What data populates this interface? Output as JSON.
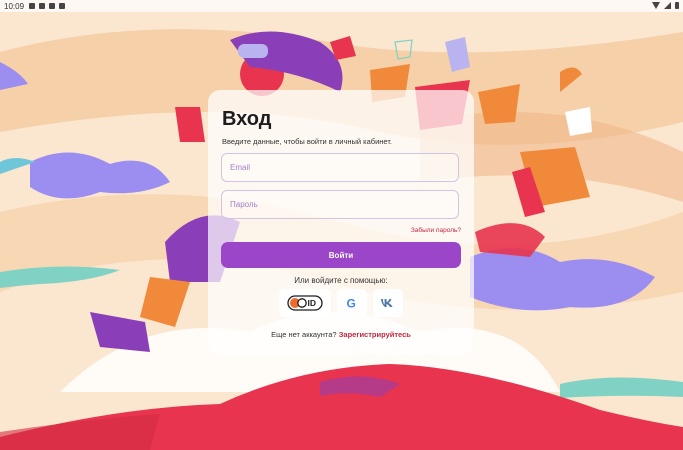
{
  "status_bar": {
    "time": "10:09"
  },
  "login": {
    "title": "Вход",
    "subtitle": "Введите данные, чтобы войти в личный кабинет.",
    "email_placeholder": "Email",
    "password_placeholder": "Пароль",
    "forgot_label": "Забыли пароль?",
    "submit_label": "Войти",
    "or_label": "Или войдите с помощью:",
    "social": {
      "okid_label": "ID",
      "google_label": "G"
    },
    "no_account_label": "Еще нет аккаунта?",
    "register_label": "Зарегистрируйтесь"
  },
  "colors": {
    "accent": "#9b45c9",
    "link": "#c2273f",
    "background": "#fbe6cf",
    "hill": "#e8344e"
  }
}
